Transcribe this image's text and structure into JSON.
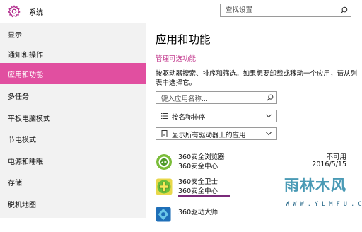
{
  "header": {
    "title": "系统",
    "search_placeholder": "查找设置"
  },
  "sidebar": {
    "items": [
      {
        "label": "显示"
      },
      {
        "label": "通知和操作"
      },
      {
        "label": "应用和功能"
      },
      {
        "label": "多任务"
      },
      {
        "label": "平板电脑模式"
      },
      {
        "label": "节电模式"
      },
      {
        "label": "电源和睡眠"
      },
      {
        "label": "存储"
      },
      {
        "label": "脱机地图"
      }
    ],
    "active_index": 2
  },
  "main": {
    "title": "应用和功能",
    "manage_link": "管理可选功能",
    "description": "按驱动器搜索、排序和筛选。如果想要卸载或移动一个应用，请从列表中选择它。",
    "search_placeholder": "键入应用名称...",
    "sort_label": "按名称排序",
    "filter_label": "显示所有驱动器上的应用",
    "apps": [
      {
        "name": "360安全浏览器",
        "publisher": "360安全中心",
        "status": "不可用",
        "date": "2016/5/15"
      },
      {
        "name": "360安全卫士",
        "publisher": "360安全中心",
        "status": "",
        "date": ""
      },
      {
        "name": "360驱动大师",
        "publisher": "",
        "status": "",
        "date": ""
      }
    ]
  },
  "watermark": {
    "text": "雨林木风",
    "url": "W W W . Y L M F U . C O M"
  },
  "colors": {
    "accent": "#e14fa0",
    "link": "#c2358b",
    "sidebar_bg": "#f2f2f2"
  }
}
